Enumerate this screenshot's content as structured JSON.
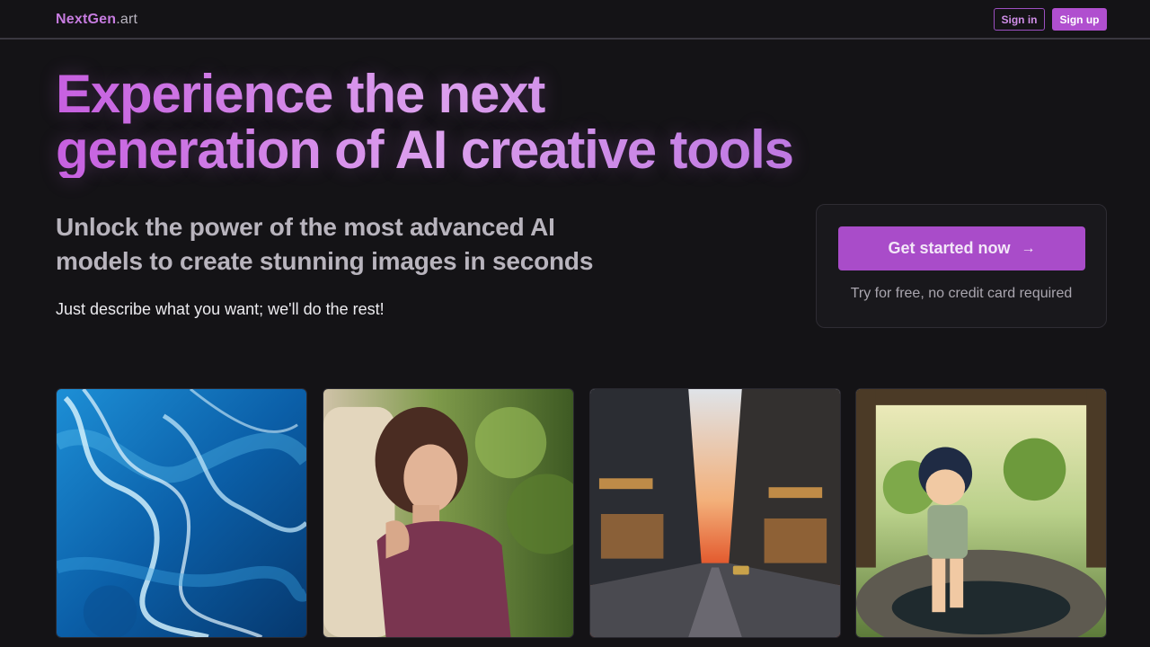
{
  "header": {
    "logo_brand": "NextGen",
    "logo_tld": ".art",
    "sign_in_label": "Sign in",
    "sign_up_label": "Sign up"
  },
  "hero": {
    "title_line1": "Experience the next",
    "title_line2": "generation of AI creative tools",
    "subtitle_line1": "Unlock the power of the most advanced AI",
    "subtitle_line2": "models to create stunning images in seconds",
    "tagline": "Just describe what you want; we'll do the rest!"
  },
  "cta": {
    "button_label": "Get started now",
    "arrow": "→",
    "note": "Try for free, no credit card required"
  },
  "gallery": {
    "items": [
      {
        "name": "blue-ribbon-abstract-image"
      },
      {
        "name": "woman-portrait-image"
      },
      {
        "name": "city-street-sunset-image"
      },
      {
        "name": "anime-boy-well-image"
      }
    ]
  },
  "colors": {
    "accent": "#b04fcf",
    "accent_light": "#d08ee8",
    "background": "#141316"
  }
}
